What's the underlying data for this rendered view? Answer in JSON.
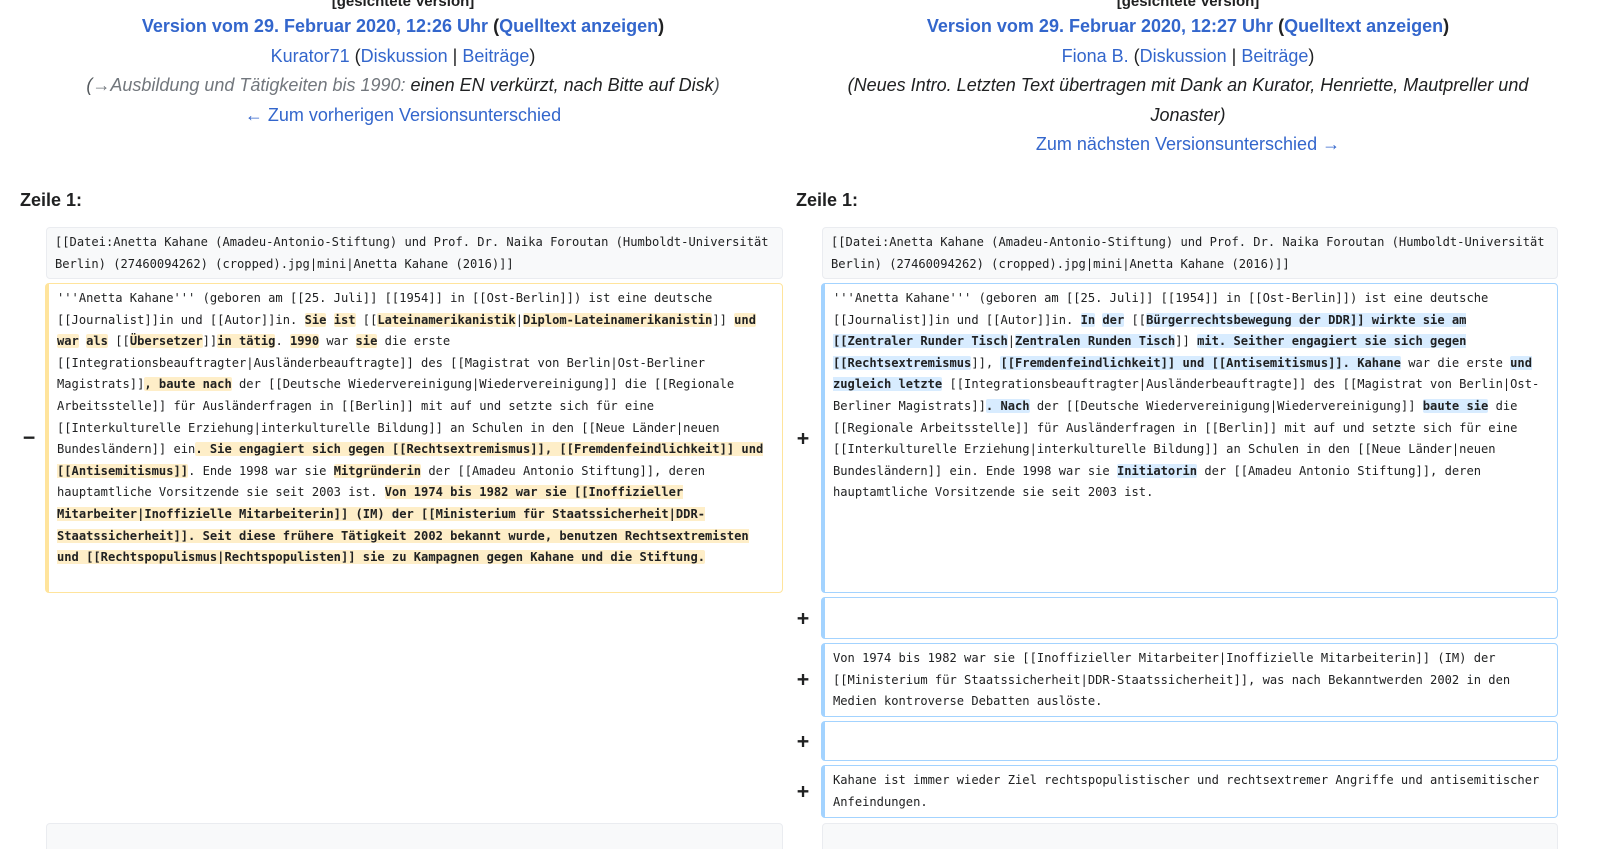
{
  "left": {
    "flag": "[gesichtete Version]",
    "version_title": "Version vom 29. Februar 2020, 12:26 Uhr",
    "source_link": "Quelltext anzeigen",
    "user": "Kurator71",
    "talk_link": "Diskussion",
    "contribs_link": "Beiträge",
    "summary_section": "→Ausbildung und Tätigkeiten bis 1990:",
    "summary_comment": "einen EN verkürzt, nach Bitte auf Disk",
    "nav_link": "← Zum vorherigen Versionsunterschied",
    "line_label": "Zeile 1:"
  },
  "right": {
    "flag": "[gesichtete Version]",
    "version_title": "Version vom 29. Februar 2020, 12:27 Uhr",
    "source_link": "Quelltext anzeigen",
    "user": "Fiona B.",
    "talk_link": "Diskussion",
    "contribs_link": "Beiträge",
    "summary_line1": "(Neues Intro. Letzten Text übertragen mit Dank an Kurator, Henriette, Mautpreller und",
    "summary_line2": "Jonaster)",
    "nav_link": "Zum nächsten Versionsunterschied →",
    "line_label": "Zeile 1:"
  },
  "markers": {
    "minus": "−",
    "plus": "+"
  },
  "context_text": "[[Datei:Anetta Kahane (Amadeu-Antonio-Stiftung) und Prof. Dr. Naika Foroutan (Humboldt-Universität Berlin) (27460094262) (cropped).jpg|mini|Anetta Kahane (2016)]]",
  "deleted_segments": [
    {
      "t": "'''Anetta Kahane''' (geboren am [[25. Juli]] [[1954]] in [[Ost-Berlin]]) ist eine deutsche [[Journalist]]in und [[Autor]]in. ",
      "h": false
    },
    {
      "t": "Sie",
      "h": true
    },
    {
      "t": " ",
      "h": false
    },
    {
      "t": "ist",
      "h": true
    },
    {
      "t": " [[",
      "h": false
    },
    {
      "t": "Lateinamerikanistik",
      "h": true
    },
    {
      "t": "|",
      "h": false
    },
    {
      "t": "Diplom-Lateinamerikanistin",
      "h": true
    },
    {
      "t": "]] ",
      "h": false
    },
    {
      "t": "und",
      "h": true
    },
    {
      "t": " ",
      "h": false
    },
    {
      "t": "war",
      "h": true
    },
    {
      "t": " ",
      "h": false
    },
    {
      "t": "als",
      "h": true
    },
    {
      "t": " [[",
      "h": false
    },
    {
      "t": "Übersetzer",
      "h": true
    },
    {
      "t": "]]",
      "h": false
    },
    {
      "t": "in tätig",
      "h": true
    },
    {
      "t": ". ",
      "h": false
    },
    {
      "t": "1990",
      "h": true
    },
    {
      "t": " war ",
      "h": false
    },
    {
      "t": "sie",
      "h": true
    },
    {
      "t": " die erste [[Integrationsbeauftragter|Ausländerbeauftragte]] des [[Magistrat von Berlin|Ost-Berliner Magistrats]]",
      "h": false
    },
    {
      "t": ", baute nach",
      "h": true
    },
    {
      "t": " der [[Deutsche Wiedervereinigung|Wiedervereinigung]] die [[Regionale Arbeitsstelle]] für Ausländerfragen in [[Berlin]] mit auf und setzte sich für eine [[Interkulturelle Erziehung|interkulturelle Bildung]] an Schulen in den [[Neue Länder|neuen Bundesländern]] ein",
      "h": false
    },
    {
      "t": ". Sie engagiert sich gegen [[Rechtsextremismus]], [[Fremdenfeindlichkeit]] und [[Antisemitismus]]",
      "h": true
    },
    {
      "t": ". Ende 1998 war sie ",
      "h": false
    },
    {
      "t": "Mitgründerin",
      "h": true
    },
    {
      "t": " der [[Amadeu Antonio Stiftung]], deren hauptamtliche Vorsitzende sie seit 2003 ist. ",
      "h": false
    },
    {
      "t": "Von 1974 bis 1982 war sie [[Inoffizieller Mitarbeiter|Inoffizielle Mitarbeiterin]] (IM) der [[Ministerium für Staatssicherheit|DDR-Staatssicherheit]]. Seit diese frühere Tätigkeit 2002 bekannt wurde, benutzen Rechtsextremisten und [[Rechtspopulismus|Rechtspopulisten]] sie zu Kampagnen gegen Kahane und die Stiftung.",
      "h": true
    }
  ],
  "added_segments": [
    {
      "t": "'''Anetta Kahane''' (geboren am [[25. Juli]] [[1954]] in [[Ost-Berlin]]) ist eine deutsche [[Journalist]]in und [[Autor]]in. ",
      "h": false
    },
    {
      "t": "In",
      "h": true
    },
    {
      "t": " ",
      "h": false
    },
    {
      "t": "der",
      "h": true
    },
    {
      "t": " [[",
      "h": false
    },
    {
      "t": "Bürgerrechtsbewegung der DDR]] wirkte sie am [[Zentraler Runder Tisch",
      "h": true
    },
    {
      "t": "|",
      "h": false
    },
    {
      "t": "Zentralen Runden Tisch",
      "h": true
    },
    {
      "t": "]] ",
      "h": false
    },
    {
      "t": "mit. Seither engagiert sie sich gegen [[Rechtsextremismus",
      "h": true
    },
    {
      "t": "]], ",
      "h": false
    },
    {
      "t": "[[Fremdenfeindlichkeit]] und [[Antisemitismus]]. Kahane",
      "h": true
    },
    {
      "t": " war die erste ",
      "h": false
    },
    {
      "t": "und zugleich letzte",
      "h": true
    },
    {
      "t": " [[Integrationsbeauftragter|Ausländerbeauftragte]] des [[Magistrat von Berlin|Ost-Berliner Magistrats]]",
      "h": false
    },
    {
      "t": ". Nach",
      "h": true
    },
    {
      "t": " der [[Deutsche Wiedervereinigung|Wiedervereinigung]] ",
      "h": false
    },
    {
      "t": "baute sie",
      "h": true
    },
    {
      "t": " die [[Regionale Arbeitsstelle]] für Ausländerfragen in [[Berlin]] mit auf und setzte sich für eine [[Interkulturelle Erziehung|interkulturelle Bildung]] an Schulen in den [[Neue Länder|neuen Bundesländern]] ein. Ende 1998 war sie ",
      "h": false
    },
    {
      "t": "Initiatorin",
      "h": true
    },
    {
      "t": " der [[Amadeu Antonio Stiftung]], deren hauptamtliche Vorsitzende sie seit 2003 ist.",
      "h": false
    }
  ],
  "added_blocks": [
    "",
    "Von 1974 bis 1982 war sie [[Inoffizieller Mitarbeiter|Inoffizielle Mitarbeiterin]] (IM) der [[Ministerium für Staatssicherheit|DDR-Staatssicherheit]], was nach Bekanntwerden 2002 in den Medien kontroverse Debatten auslöste.",
    "",
    "Kahane ist immer wieder Ziel rechtspopulistischer und rechtsextremer Angriffe und antisemitischer Anfeindungen."
  ]
}
